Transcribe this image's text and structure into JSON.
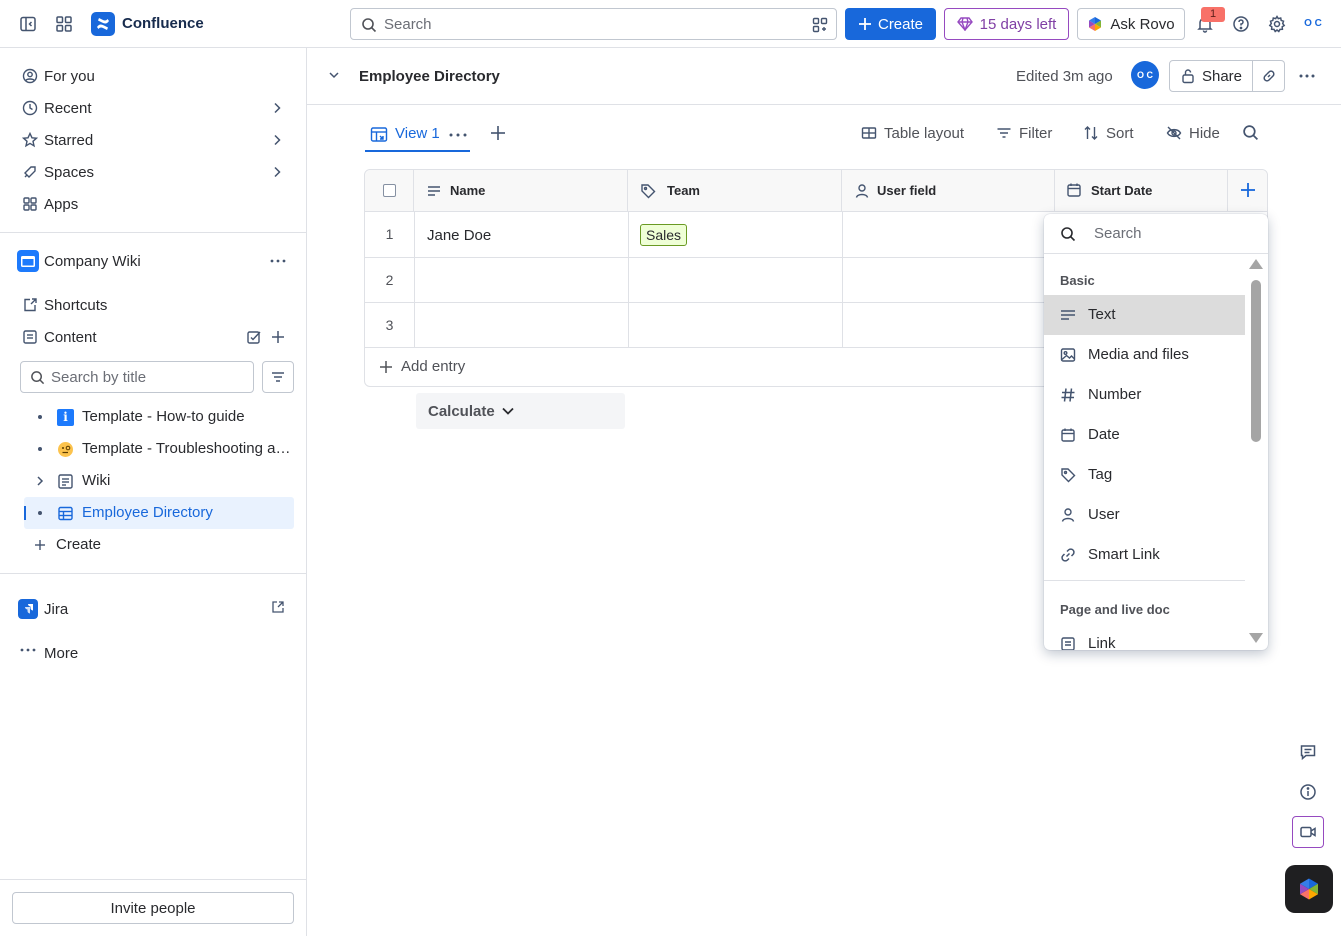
{
  "topbar": {
    "app_name": "Confluence",
    "search_placeholder": "Search",
    "create_label": "Create",
    "trial_label": "15 days left",
    "rovo_label": "Ask Rovo",
    "notification_count": "1",
    "profile_initials": "O C"
  },
  "sidebar": {
    "nav": [
      {
        "label": "For you",
        "icon": "user-circle-icon"
      },
      {
        "label": "Recent",
        "icon": "clock-icon"
      },
      {
        "label": "Starred",
        "icon": "star-icon"
      },
      {
        "label": "Spaces",
        "icon": "spaces-icon"
      },
      {
        "label": "Apps",
        "icon": "apps-icon"
      }
    ],
    "space_name": "Company Wiki",
    "shortcuts_label": "Shortcuts",
    "content_label": "Content",
    "search_placeholder": "Search by title",
    "tree": [
      {
        "label": "Template - How-to guide",
        "icon": "info-icon"
      },
      {
        "label": "Template - Troubleshooting article",
        "icon": "emoji-face-icon"
      },
      {
        "label": "Wiki",
        "icon": "page-icon"
      },
      {
        "label": "Employee Directory",
        "icon": "database-icon"
      }
    ],
    "create_label": "Create",
    "jira_label": "Jira",
    "more_label": "More",
    "invite_label": "Invite people"
  },
  "page": {
    "title": "Employee Directory",
    "edited": "Edited 3m ago",
    "avatar_initials": "O C",
    "share_label": "Share"
  },
  "toolbar": {
    "view_label": "View 1",
    "table_layout": "Table layout",
    "filter": "Filter",
    "sort": "Sort",
    "hide": "Hide"
  },
  "table": {
    "columns": [
      "Name",
      "Team",
      "User field",
      "Start Date"
    ],
    "rows": [
      {
        "num": "1",
        "name": "Jane Doe",
        "team": "Sales"
      },
      {
        "num": "2",
        "name": "",
        "team": ""
      },
      {
        "num": "3",
        "name": "",
        "team": ""
      }
    ],
    "add_entry": "Add entry",
    "calculate": "Calculate"
  },
  "field_menu": {
    "search_placeholder": "Search",
    "section_basic": "Basic",
    "items": [
      "Text",
      "Media and files",
      "Number",
      "Date",
      "Tag",
      "User",
      "Smart Link"
    ],
    "section_page": "Page and live doc",
    "page_items": [
      "Link"
    ]
  },
  "colors": {
    "brand": "#1868db",
    "trial": "#803fa5",
    "tag_bg": "#efffd6"
  }
}
